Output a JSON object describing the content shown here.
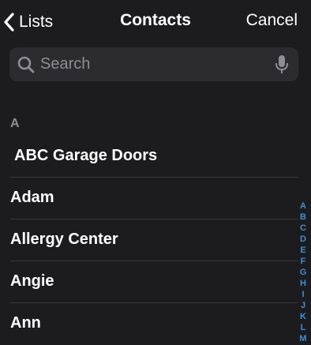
{
  "nav": {
    "back_label": "Lists",
    "title": "Contacts",
    "cancel_label": "Cancel"
  },
  "search": {
    "placeholder": "Search"
  },
  "section": {
    "header": "A"
  },
  "contacts": [
    "ABC Garage Doors",
    "Adam",
    "Allergy Center",
    "Angie",
    "Ann"
  ],
  "index_letters": [
    "A",
    "B",
    "C",
    "D",
    "E",
    "F",
    "G",
    "H",
    "I",
    "J",
    "K",
    "L",
    "M"
  ],
  "colors": {
    "background": "#1c1c1e",
    "search_field": "#2c2c2e",
    "secondary_text": "#8e8e93",
    "index_accent": "#3a8fd9",
    "divider": "#38383a"
  }
}
